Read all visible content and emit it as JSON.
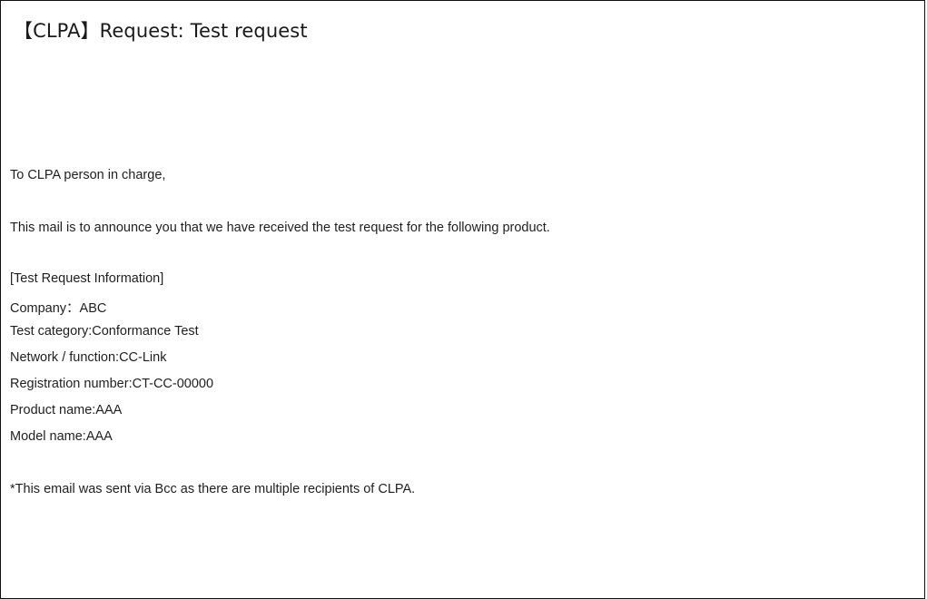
{
  "email": {
    "subject": "【CLPA】Request:  Test request",
    "greeting": "To CLPA person in charge,",
    "intro": "This mail is to announce you that we have received the test request for the following product.",
    "section_header": "[Test Request Information]",
    "fields": [
      "Company：ABC",
      "Test category:Conformance Test",
      "Network / function:CC-Link",
      "Registration number:CT-CC-00000",
      "Product name:AAA",
      "Model name:AAA"
    ],
    "note": "*This email was sent via Bcc as there are multiple recipients of CLPA."
  }
}
